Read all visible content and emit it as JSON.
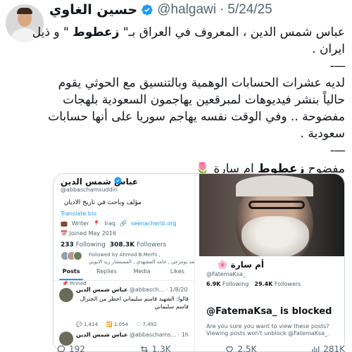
{
  "tweet": {
    "author_name": "حسين الغاوي",
    "handle": "@halgawi",
    "dot": "·",
    "date": "5/24/25",
    "lines": [
      "عباس شمس الدين ، المعروف في العراق بـ\" زعطوط \" و ذيل",
      "ايران .",
      "—-",
      "لديه عشرات الحسابات الوهمية وبالتنسيق مع الحوثي يقوم",
      "حالياً بنشر فيديوهات لمبرقعين يهاجمون السعودية بلهجات",
      "مفضوحة .. وفي الوقت نفسه يهاجم سوريا على أنها حسابات",
      "سعودية .",
      "—-",
      "مفضوح زعطوط ام سارة 🌷"
    ],
    "bold_word": "زعطوط"
  },
  "left_panel": {
    "name": "عباس شمس الدين",
    "handle": "@abbaschamsuddin",
    "bio": "مؤلف وباحث في تاريخ الاديان",
    "translate": "Translate bio",
    "writer": "Writer",
    "location": "Iraq",
    "link": "seenacherib.org",
    "joined": "Joined May 2016",
    "following_count": "233",
    "following_label": "Following",
    "followers_count": "308.3K",
    "followers_label": "Followers",
    "followed_by": "Followed by Ahmad B.Merhi ,",
    "followed_by_2": "أحمد بومرعي , حامد المشهدي , المستشار زيد الايوبي",
    "tabs": [
      "Posts",
      "Replies",
      "Media",
      "Likes"
    ],
    "pinned": "Pinned",
    "post1_name": "عباس شمس الدين",
    "post1_meta": "@abbasch... · 1/8/20",
    "post1_text": "قالوا: الشهيد قاسم سليماني اخطر من الجنرال قاسم سليماني",
    "stats": [
      "1,414",
      "1,054",
      "7,492"
    ],
    "post2_name": "عباس شمس الدين",
    "post2_meta": "@abbaschams... · 1h"
  },
  "right_panel": {
    "name": "أم سارة 🌸",
    "handle": "@FatemaKsa_",
    "following_count": "6.9K",
    "following_label": "Following",
    "followers_count": "29.4K",
    "followers_label": "Followers",
    "blocked": "@FatemaKsa_ is blocked",
    "question": "Are you sure you want to view these posts?",
    "question_2": "Viewing posts won't unblock @FatemaKsa_."
  },
  "actions": {
    "replies": "192",
    "reposts": "1.3K",
    "likes": "2.5K",
    "views": "281K"
  },
  "colors": {
    "accent": "#1d9bf0",
    "text": "#0f1419",
    "muted": "#536471",
    "border": "#cfd9de"
  }
}
